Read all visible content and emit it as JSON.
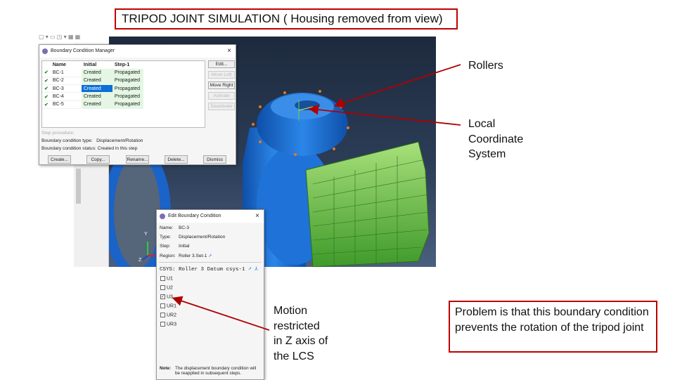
{
  "slide": {
    "title": "TRIPOD JOINT SIMULATION ( Housing removed from view)",
    "annotations": {
      "rollers": "Rollers",
      "lcs": [
        "Local",
        "Coordinate",
        "System"
      ],
      "motion": [
        "Motion",
        "restricted",
        "in Z axis of",
        "the LCS"
      ],
      "problem": "Problem is that this boundary condition prevents the rotation of the tripod joint"
    }
  },
  "viewport": {
    "triad": {
      "y": "Y",
      "z": "Z"
    }
  },
  "bc_manager": {
    "title": "Boundary Condition Manager",
    "close": "×",
    "columns": [
      "Name",
      "Initial",
      "Step-1"
    ],
    "rows": [
      {
        "name": "BC-1",
        "initial": "Created",
        "step1": "Propagated"
      },
      {
        "name": "BC-2",
        "initial": "Created",
        "step1": "Propagated"
      },
      {
        "name": "BC-3",
        "initial": "Created",
        "step1": "Propagated"
      },
      {
        "name": "BC-4",
        "initial": "Created",
        "step1": "Propagated"
      },
      {
        "name": "BC-5",
        "initial": "Created",
        "step1": "Propagated"
      }
    ],
    "side_buttons": [
      "Edit...",
      "Move Left",
      "Move Right",
      "Activate",
      "Deactivate"
    ],
    "step_procedure": "Step procedure:",
    "type_label": "Boundary condition type:",
    "type_value": "Displacement/Rotation",
    "status_label": "Boundary condition status:",
    "status_value": "Created in this step",
    "buttons": [
      "Create...",
      "Copy...",
      "Rename...",
      "Delete...",
      "Dismiss"
    ]
  },
  "edit_bc": {
    "title": "Edit Boundary Condition",
    "close": "×",
    "name_label": "Name:",
    "name": "BC-3",
    "type_label": "Type:",
    "type": "Displacement/Rotation",
    "step_label": "Step:",
    "step": "Initial",
    "region_label": "Region:",
    "region": "Roller 3.Set-1",
    "csys": "CSYS: Roller 3 Datum csys-1",
    "dofs": [
      {
        "label": "U1",
        "checked": false
      },
      {
        "label": "U2",
        "checked": false
      },
      {
        "label": "U3",
        "checked": true
      },
      {
        "label": "UR1",
        "checked": false
      },
      {
        "label": "UR2",
        "checked": false
      },
      {
        "label": "UR3",
        "checked": false
      }
    ],
    "note_label": "Note:",
    "note": "The displacement boundary condition will be reapplied in subsequent steps."
  }
}
